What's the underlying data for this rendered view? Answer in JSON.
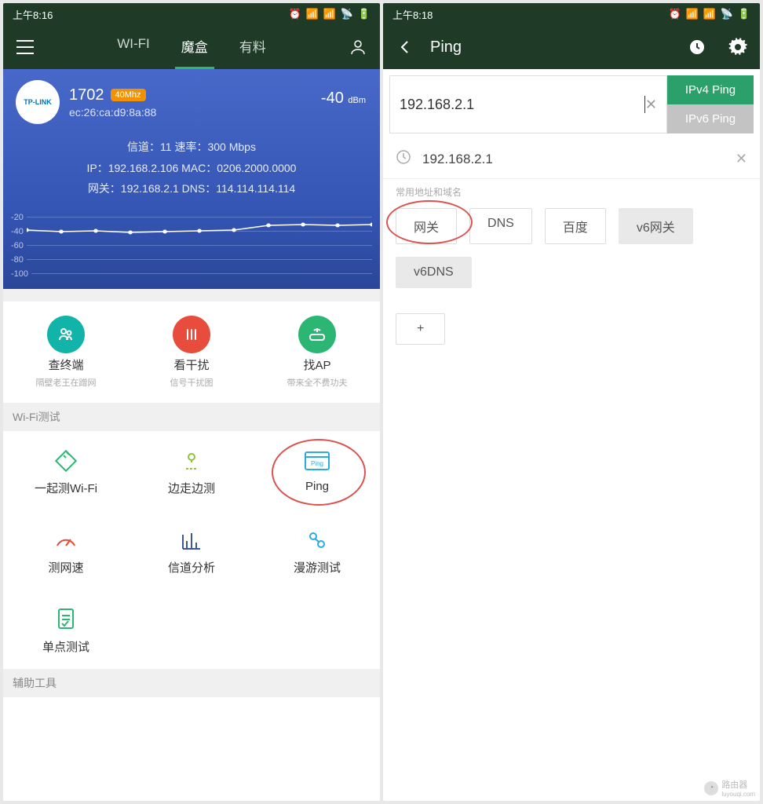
{
  "left": {
    "status": {
      "time": "上午8:16"
    },
    "tabs": {
      "wifi": "WI-FI",
      "mohe": "魔盒",
      "youliao": "有料"
    },
    "wifi": {
      "brand": "TP-LINK",
      "ssid": "1702",
      "mhz": "40Mhz",
      "mac": "ec:26:ca:d9:8a:88",
      "signal_value": "-40",
      "signal_unit": "dBm",
      "line1": "信道：11  速率：300 Mbps",
      "line2": "IP：192.168.2.106  MAC：0206.2000.0000",
      "line3": "网关：192.168.2.1  DNS：114.114.114.114"
    },
    "chart_labels": {
      "a": "-20",
      "b": "-40",
      "c": "-60",
      "d": "-80",
      "e": "-100"
    },
    "featured": [
      {
        "label": "查终端",
        "sub": "隔壁老王在蹭网"
      },
      {
        "label": "看干扰",
        "sub": "信号干扰图"
      },
      {
        "label": "找AP",
        "sub": "带来全不费功夫"
      }
    ],
    "section_wifi_title": "Wi-Fi测试",
    "wifi_tools": {
      "a": "一起测Wi-Fi",
      "b": "边走边测",
      "c": "Ping",
      "d": "测网速",
      "e": "信道分析",
      "f": "漫游测试",
      "g": "单点测试"
    },
    "section_aux_title": "辅助工具"
  },
  "right": {
    "status": {
      "time": "上午8:18"
    },
    "title": "Ping",
    "input_value": "192.168.2.1",
    "ipv4": "IPv4 Ping",
    "ipv6": "IPv6 Ping",
    "history_item": "192.168.2.1",
    "tags_label": "常用地址和域名",
    "tags": {
      "gateway": "网关",
      "dns": "DNS",
      "baidu": "百度",
      "v6gw": "v6网关",
      "v6dns": "v6DNS",
      "plus": "+"
    }
  },
  "watermark": {
    "text": "路由器",
    "sub": "luyouqi.com"
  }
}
